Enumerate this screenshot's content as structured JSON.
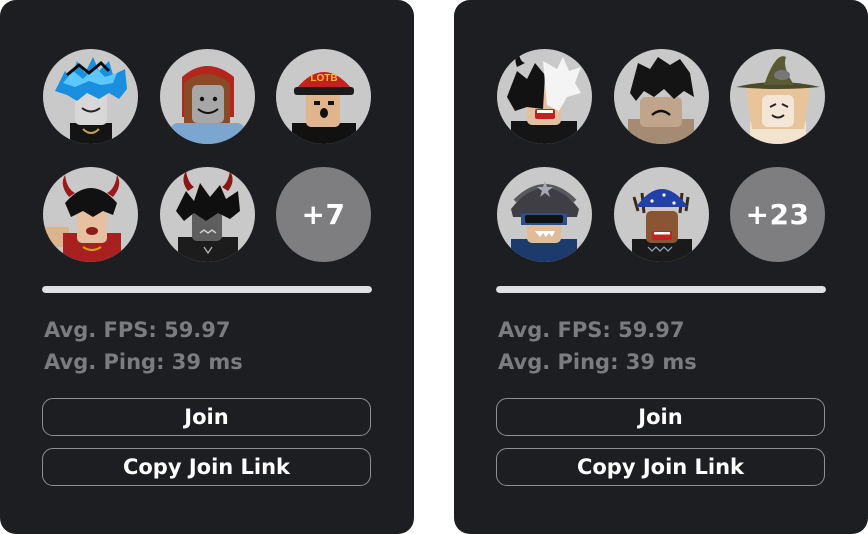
{
  "colors": {
    "card_background": "#1d1e21",
    "avatar_background": "#c9c9c9",
    "more_badge": "#7e7e80",
    "stat_text": "#7b7c80",
    "button_border": "#8e8f93",
    "button_text": "#ffffff"
  },
  "servers": [
    {
      "avatars": [
        {
          "icon": "avatar-blue-hair-icon"
        },
        {
          "icon": "avatar-red-hood-icon"
        },
        {
          "icon": "avatar-red-cap-icon"
        },
        {
          "icon": "avatar-red-horns-icon"
        },
        {
          "icon": "avatar-horns-dark-hair-icon"
        }
      ],
      "more_players": "+7",
      "capacity_fill": 1.0,
      "fps": "Avg. FPS: 59.97",
      "ping": "Avg. Ping: 39 ms",
      "join_label": "Join",
      "copy_link_label": "Copy Join Link"
    },
    {
      "avatars": [
        {
          "icon": "avatar-white-mask-icon"
        },
        {
          "icon": "avatar-sad-face-icon"
        },
        {
          "icon": "avatar-witch-hat-icon"
        },
        {
          "icon": "avatar-fur-hat-icon"
        },
        {
          "icon": "avatar-blue-bandana-icon"
        }
      ],
      "more_players": "+23",
      "capacity_fill": 1.0,
      "fps": "Avg. FPS: 59.97",
      "ping": "Avg. Ping: 39 ms",
      "join_label": "Join",
      "copy_link_label": "Copy Join Link"
    }
  ]
}
